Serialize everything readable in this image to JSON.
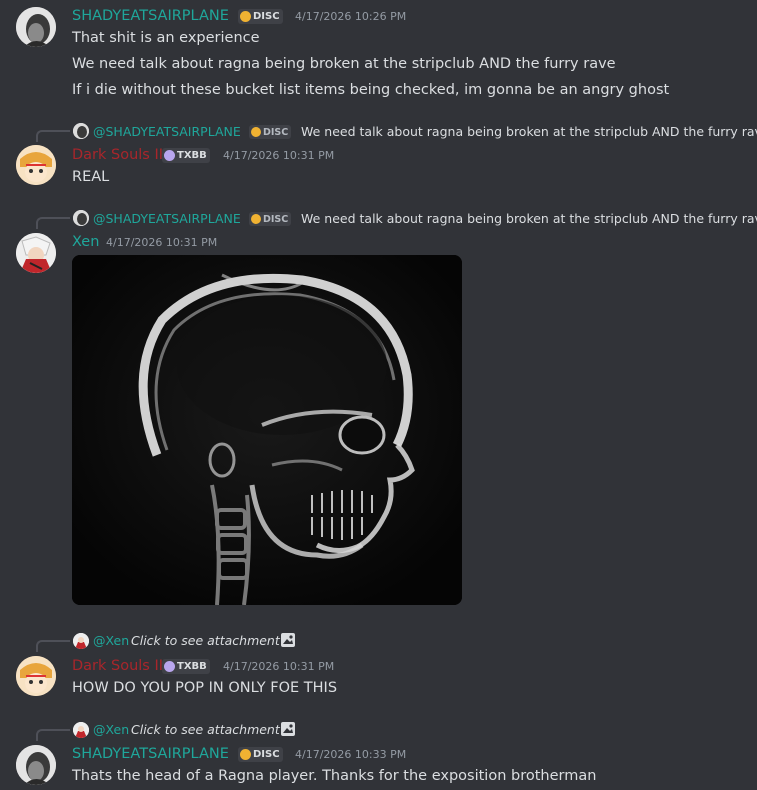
{
  "messages": [
    {
      "author": "SHADYEATSAIRPLANE",
      "tag": "DISC",
      "timestamp": "4/17/2026 10:26 PM",
      "lines": [
        "That shit is an experience",
        "We need talk about ragna being broken at the stripclub AND the furry rave",
        "If i die without these bucket list items being checked, im gonna be an angry ghost"
      ]
    },
    {
      "reply": {
        "mention": "@SHADYEATSAIRPLANE",
        "tag": "DISC",
        "text": "We need talk about ragna being broken at the stripclub AND the furry rave"
      },
      "author": "Dark Souls II",
      "tag": "TXBB",
      "timestamp": "4/17/2026 10:31 PM",
      "lines": [
        "REAL"
      ]
    },
    {
      "reply": {
        "mention": "@SHADYEATSAIRPLANE",
        "tag": "DISC",
        "text": "We need talk about ragna being broken at the stripclub AND the furry rave"
      },
      "author": "Xen",
      "timestamp": "4/17/2026 10:31 PM",
      "attachment": "skull-xray-image"
    },
    {
      "reply": {
        "mention": "@Xen",
        "text": "Click to see attachment",
        "icon": "image-icon"
      },
      "author": "Dark Souls II",
      "tag": "TXBB",
      "timestamp": "4/17/2026 10:31 PM",
      "lines": [
        "HOW DO YOU POP IN ONLY FOE THIS"
      ]
    },
    {
      "reply": {
        "mention": "@Xen",
        "text": "Click to see attachment",
        "icon": "image-icon"
      },
      "author": "SHADYEATSAIRPLANE",
      "tag": "DISC",
      "timestamp": "4/17/2026 10:33 PM",
      "lines": [
        "Thats the head of a Ragna player. Thanks for the exposition brotherman"
      ]
    }
  ],
  "colors": {
    "background": "#313338",
    "shady": "#1fa79b",
    "darksouls": "#a8262b",
    "xen": "#1fa79b",
    "text": "#dbdee1",
    "muted": "#949ba4"
  }
}
